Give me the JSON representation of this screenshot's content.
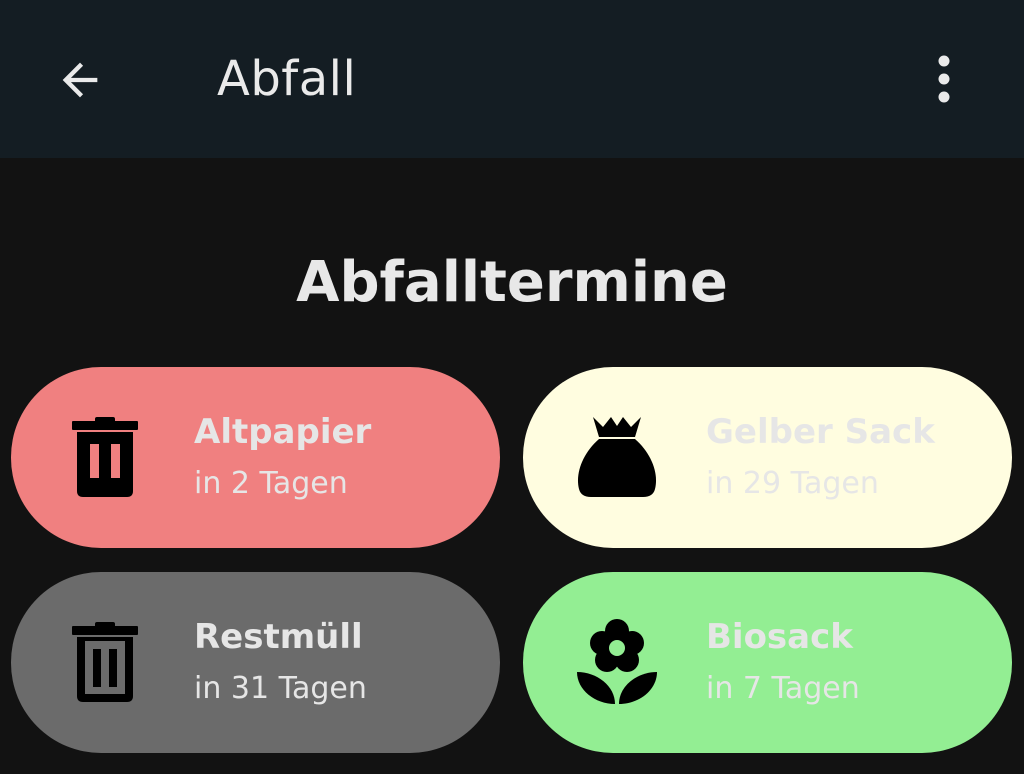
{
  "appbar": {
    "title": "Abfall",
    "back_icon": "arrow-left-icon",
    "menu_icon": "more-vertical-icon"
  },
  "section": {
    "title": "Abfalltermine"
  },
  "cards": [
    {
      "name": "Altpapier",
      "when": "in 2 Tagen",
      "icon": "trash-can-icon",
      "color": "#f08080"
    },
    {
      "name": "Gelber Sack",
      "when": "in 29 Tagen",
      "icon": "money-bag-icon",
      "color": "#fffde0"
    },
    {
      "name": "Restmüll",
      "when": "in 31 Tagen",
      "icon": "trash-can-outline-icon",
      "color": "#6b6b6b"
    },
    {
      "name": "Biosack",
      "when": "in 7 Tagen",
      "icon": "flower-icon",
      "color": "#93ee93"
    }
  ],
  "colors": {
    "appbar_bg": "#141d23",
    "page_bg": "#121212",
    "text": "#e6e6e6"
  }
}
